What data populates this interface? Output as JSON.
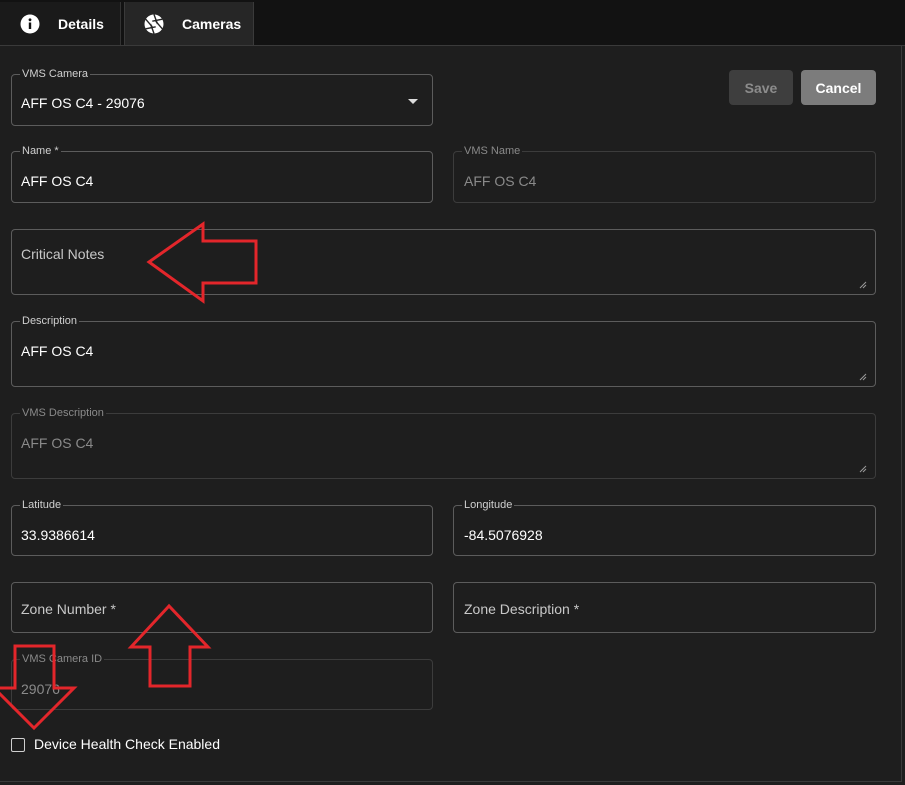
{
  "tabs": [
    {
      "label": "Details",
      "icon": "info-icon"
    },
    {
      "label": "Cameras",
      "icon": "aperture-icon"
    }
  ],
  "buttons": {
    "save": "Save",
    "cancel": "Cancel"
  },
  "fields": {
    "vms_camera": {
      "label": "VMS Camera",
      "value": "AFF OS C4 - 29076"
    },
    "name": {
      "label": "Name *",
      "value": "AFF OS C4"
    },
    "vms_name": {
      "label": "VMS Name",
      "value": "AFF OS C4"
    },
    "critical_notes": {
      "placeholder": "Critical Notes"
    },
    "description": {
      "label": "Description",
      "value": "AFF OS C4"
    },
    "vms_description": {
      "label": "VMS Description",
      "value": "AFF OS C4"
    },
    "latitude": {
      "label": "Latitude",
      "value": "33.9386614"
    },
    "longitude": {
      "label": "Longitude",
      "value": "-84.5076928"
    },
    "zone_number": {
      "placeholder": "Zone Number *"
    },
    "zone_description": {
      "placeholder": "Zone Description *"
    },
    "vms_camera_id": {
      "label": "VMS Camera ID",
      "value": "29076"
    }
  },
  "checkbox": {
    "label": "Device Health Check Enabled",
    "checked": false
  },
  "colors": {
    "background": "#1e1e1e",
    "annotation": "#e3262b",
    "cancel_button": "#7c7c7c"
  }
}
